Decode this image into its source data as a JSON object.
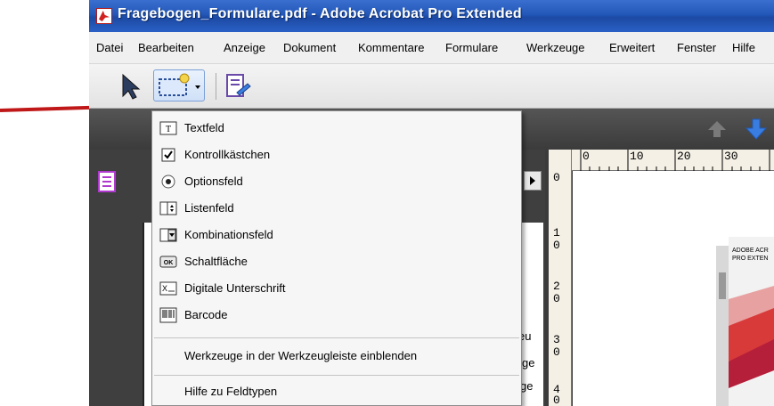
{
  "window": {
    "title": "Fragebogen_Formulare.pdf - Adobe Acrobat Pro Extended"
  },
  "menubar": {
    "items": [
      "Datei",
      "Bearbeiten",
      "Anzeige",
      "Dokument",
      "Kommentare",
      "Formulare",
      "Werkzeuge",
      "Erweitert",
      "Fenster",
      "Hilfe"
    ]
  },
  "dropdown": {
    "items": [
      {
        "label": "Textfeld",
        "icon": "text-field-icon"
      },
      {
        "label": "Kontrollkästchen",
        "icon": "checkbox-icon"
      },
      {
        "label": "Optionsfeld",
        "icon": "radio-icon"
      },
      {
        "label": "Listenfeld",
        "icon": "listbox-icon"
      },
      {
        "label": "Kombinationsfeld",
        "icon": "combobox-icon"
      },
      {
        "label": "Schaltfläche",
        "icon": "button-icon"
      },
      {
        "label": "Digitale Unterschrift",
        "icon": "signature-icon"
      },
      {
        "label": "Barcode",
        "icon": "barcode-icon"
      }
    ],
    "show_tools_label": "Werkzeuge in der Werkzeugleiste einblenden",
    "help_label": "Hilfe zu Feldtypen"
  },
  "ruler": {
    "h_labels": [
      "0",
      "10",
      "20",
      "30"
    ],
    "v_labels": [
      "0",
      "1",
      "0",
      "2",
      "0",
      "3",
      "0",
      "4",
      "0"
    ]
  },
  "panel": {
    "fragments": [
      "eu",
      "ge",
      "ge"
    ]
  },
  "product": {
    "line1": "ADOBE ACR",
    "line2": "PRO EXTEN"
  },
  "colors": {
    "titlebar": "#2357b8",
    "annotation_arrow": "#c01818",
    "nav_arrow": "#3a7de0"
  }
}
